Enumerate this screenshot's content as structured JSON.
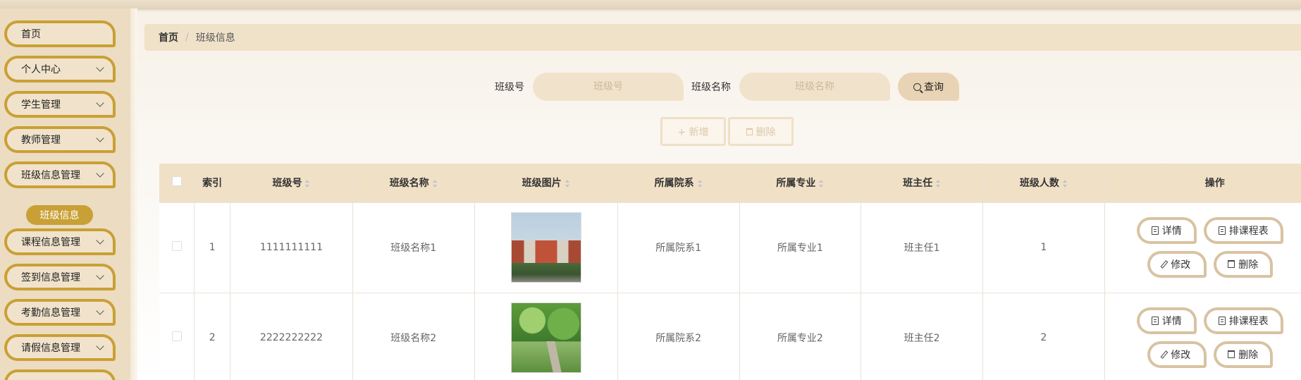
{
  "sidebar": {
    "items": [
      {
        "label": "首页",
        "has_children": false
      },
      {
        "label": "个人中心",
        "has_children": true
      },
      {
        "label": "学生管理",
        "has_children": true
      },
      {
        "label": "教师管理",
        "has_children": true
      },
      {
        "label": "班级信息管理",
        "has_children": true
      },
      {
        "label": "课程信息管理",
        "has_children": true
      },
      {
        "label": "签到信息管理",
        "has_children": true
      },
      {
        "label": "考勤信息管理",
        "has_children": true
      },
      {
        "label": "请假信息管理",
        "has_children": true
      }
    ],
    "active_sub": "班级信息"
  },
  "breadcrumb": {
    "home": "首页",
    "separator": "/",
    "current": "班级信息"
  },
  "search": {
    "class_no_label": "班级号",
    "class_no_placeholder": "班级号",
    "class_name_label": "班级名称",
    "class_name_placeholder": "班级名称",
    "query_button": "查询"
  },
  "actions": {
    "add": "+ 新增",
    "delete": "删除"
  },
  "table": {
    "headers": {
      "index": "索引",
      "class_no": "班级号",
      "class_name": "班级名称",
      "class_image": "班级图片",
      "department": "所属院系",
      "major": "所属专业",
      "head_teacher": "班主任",
      "count": "班级人数",
      "operation": "操作"
    },
    "rows": [
      {
        "index": "1",
        "class_no": "1111111111",
        "class_name": "班级名称1",
        "department": "所属院系1",
        "major": "所属专业1",
        "head_teacher": "班主任1",
        "count": "1"
      },
      {
        "index": "2",
        "class_no": "2222222222",
        "class_name": "班级名称2",
        "department": "所属院系2",
        "major": "所属专业2",
        "head_teacher": "班主任2",
        "count": "2"
      }
    ],
    "row_buttons": {
      "detail": "详情",
      "schedule": "排课程表",
      "edit": "修改",
      "delete": "删除"
    }
  },
  "colors": {
    "accent": "#c9a035",
    "header_bg": "#f0e0c6",
    "button_border": "#d8c3a2"
  }
}
